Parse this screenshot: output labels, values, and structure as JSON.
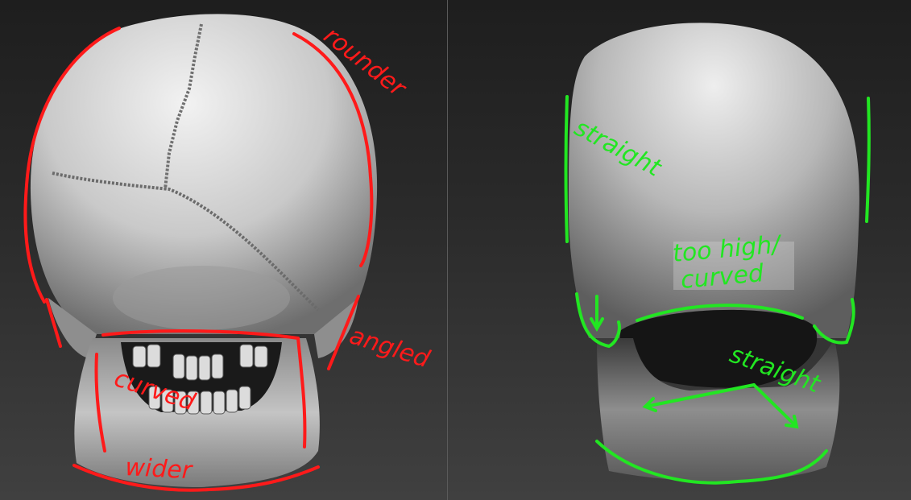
{
  "colors": {
    "background_top": "#1e1e1e",
    "background_bottom": "#404040",
    "divider": "#5a5a5a",
    "red_markup": "#ff1a1a",
    "green_markup": "#22e622",
    "skull_light": "#d8d8d8",
    "skull_shadow": "#6a6a6a"
  },
  "left_panel": {
    "subject": "reference skull, posterior view",
    "annotations": {
      "rounder": "rounder",
      "angled": "angled",
      "curved": "curved",
      "wider": "wider"
    }
  },
  "right_panel": {
    "subject": "sculpted skull, posterior view",
    "annotations": {
      "straight_top": "straight",
      "too_high_line1": "too high/",
      "too_high_line2": "curved",
      "straight_bottom": "straight"
    }
  }
}
